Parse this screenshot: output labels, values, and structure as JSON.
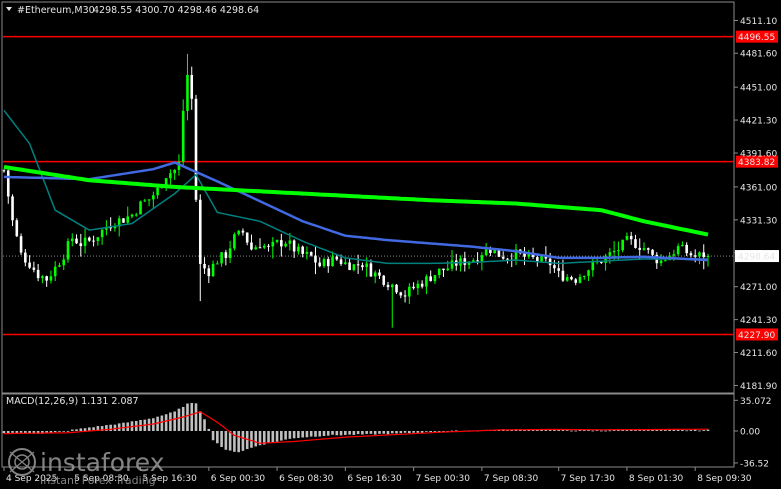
{
  "header": {
    "symbol": "#Ethereum,M30",
    "ohlc": "4298.55 4300.70 4298.46 4298.64"
  },
  "colors": {
    "background": "#000000",
    "bull_candle": "#00ff00",
    "bear_candle": "#ffffff",
    "ma_slow": "#00ff00",
    "ma_mid": "#4169e1",
    "ma_fast": "#008080",
    "level_lines": "#ff0000",
    "macd_hist": "#c0c0c0",
    "macd_signal": "#ff0000"
  },
  "watermark": {
    "brand": "instaforex",
    "tagline": "Instant Forex Trading",
    "icon": "instaforex-logo-icon"
  },
  "chart_data": {
    "type": "candlestick",
    "title": "#Ethereum,M30",
    "price_axis": {
      "ticks": [
        4511.1,
        4481.6,
        4451.0,
        4421.3,
        4391.6,
        4361.0,
        4331.3,
        4301.6,
        4271.0,
        4241.3,
        4211.6,
        4181.9
      ],
      "tick_labels": [
        "4511.10",
        "4481.60",
        "4451.00",
        "4421.30",
        "4391.60",
        "4361.00",
        "4331.30",
        "4301.60",
        "4271.00",
        "4241.30",
        "4211.60",
        "4181.90"
      ],
      "ylim": [
        4176.0,
        4526.0
      ]
    },
    "time_axis": {
      "labels": [
        "4 Sep 2025",
        "5 Sep 08:30",
        "5 Sep 16:30",
        "6 Sep 00:30",
        "6 Sep 08:30",
        "6 Sep 16:30",
        "7 Sep 00:30",
        "7 Sep 08:30",
        "7 Sep 17:30",
        "8 Sep 01:30",
        "8 Sep 09:30"
      ],
      "bar_index": [
        0,
        16,
        32,
        48,
        64,
        80,
        96,
        112,
        130,
        146,
        162
      ]
    },
    "bar_count": 166,
    "horizontal_levels": [
      {
        "price": 4496.55,
        "label": "4496.55"
      },
      {
        "price": 4383.82,
        "label": "4383.82"
      },
      {
        "price": 4227.9,
        "label": "4227.90"
      }
    ],
    "current_price": {
      "price": 4298.64,
      "label": "4298.64"
    },
    "close_anchors": [
      [
        0,
        4376
      ],
      [
        2,
        4330
      ],
      [
        4,
        4300
      ],
      [
        6,
        4292
      ],
      [
        8,
        4282
      ],
      [
        10,
        4278
      ],
      [
        12,
        4288
      ],
      [
        14,
        4300
      ],
      [
        16,
        4315
      ],
      [
        18,
        4310
      ],
      [
        20,
        4312
      ],
      [
        22,
        4318
      ],
      [
        24,
        4325
      ],
      [
        26,
        4330
      ],
      [
        28,
        4332
      ],
      [
        30,
        4336
      ],
      [
        32,
        4345
      ],
      [
        34,
        4350
      ],
      [
        36,
        4358
      ],
      [
        38,
        4372
      ],
      [
        40,
        4376
      ],
      [
        41,
        4382
      ],
      [
        42,
        4430
      ],
      [
        43,
        4462
      ],
      [
        44,
        4440
      ],
      [
        45,
        4350
      ],
      [
        46,
        4290
      ],
      [
        48,
        4285
      ],
      [
        50,
        4295
      ],
      [
        52,
        4300
      ],
      [
        54,
        4315
      ],
      [
        56,
        4320
      ],
      [
        58,
        4305
      ],
      [
        60,
        4310
      ],
      [
        62,
        4305
      ],
      [
        64,
        4310
      ],
      [
        66,
        4312
      ],
      [
        68,
        4305
      ],
      [
        70,
        4300
      ],
      [
        72,
        4298
      ],
      [
        74,
        4290
      ],
      [
        76,
        4294
      ],
      [
        78,
        4296
      ],
      [
        80,
        4292
      ],
      [
        82,
        4290
      ],
      [
        84,
        4292
      ],
      [
        86,
        4285
      ],
      [
        88,
        4280
      ],
      [
        90,
        4275
      ],
      [
        92,
        4270
      ],
      [
        94,
        4264
      ],
      [
        96,
        4270
      ],
      [
        98,
        4275
      ],
      [
        100,
        4280
      ],
      [
        102,
        4285
      ],
      [
        104,
        4288
      ],
      [
        106,
        4292
      ],
      [
        108,
        4294
      ],
      [
        110,
        4296
      ],
      [
        112,
        4302
      ],
      [
        114,
        4305
      ],
      [
        116,
        4300
      ],
      [
        118,
        4298
      ],
      [
        120,
        4300
      ],
      [
        122,
        4298
      ],
      [
        124,
        4296
      ],
      [
        126,
        4294
      ],
      [
        128,
        4292
      ],
      [
        130,
        4282
      ],
      [
        132,
        4280
      ],
      [
        134,
        4278
      ],
      [
        136,
        4285
      ],
      [
        138,
        4290
      ],
      [
        140,
        4295
      ],
      [
        142,
        4300
      ],
      [
        144,
        4305
      ],
      [
        146,
        4312
      ],
      [
        148,
        4310
      ],
      [
        150,
        4306
      ],
      [
        152,
        4298
      ],
      [
        154,
        4294
      ],
      [
        156,
        4300
      ],
      [
        158,
        4306
      ],
      [
        160,
        4302
      ],
      [
        162,
        4298
      ],
      [
        164,
        4300
      ],
      [
        165,
        4298.64
      ]
    ],
    "ma_slow_anchors": [
      [
        0,
        4379
      ],
      [
        20,
        4367
      ],
      [
        40,
        4361
      ],
      [
        60,
        4357
      ],
      [
        80,
        4353
      ],
      [
        100,
        4349
      ],
      [
        120,
        4346
      ],
      [
        140,
        4340
      ],
      [
        150,
        4330
      ],
      [
        165,
        4318
      ]
    ],
    "ma_mid_anchors": [
      [
        0,
        4370
      ],
      [
        20,
        4368
      ],
      [
        35,
        4377
      ],
      [
        40,
        4383
      ],
      [
        50,
        4366
      ],
      [
        60,
        4348
      ],
      [
        70,
        4330
      ],
      [
        80,
        4317
      ],
      [
        90,
        4313
      ],
      [
        100,
        4310
      ],
      [
        110,
        4307
      ],
      [
        120,
        4303
      ],
      [
        130,
        4297
      ],
      [
        140,
        4297
      ],
      [
        150,
        4298
      ],
      [
        165,
        4295
      ]
    ],
    "ma_fast_anchors": [
      [
        0,
        4430
      ],
      [
        6,
        4400
      ],
      [
        12,
        4340
      ],
      [
        20,
        4322
      ],
      [
        30,
        4328
      ],
      [
        40,
        4355
      ],
      [
        45,
        4372
      ],
      [
        50,
        4338
      ],
      [
        60,
        4330
      ],
      [
        70,
        4312
      ],
      [
        80,
        4297
      ],
      [
        90,
        4292
      ],
      [
        100,
        4292
      ],
      [
        110,
        4293
      ],
      [
        120,
        4295
      ],
      [
        130,
        4292
      ],
      [
        140,
        4294
      ],
      [
        150,
        4296
      ],
      [
        165,
        4296
      ]
    ],
    "macd": {
      "label": "MACD(12,26,9) 1.131 2.087",
      "ticks": [
        35.072,
        0.0,
        -36.52
      ],
      "tick_labels": [
        "35.072",
        "0.00",
        "-36.52"
      ],
      "ylim": [
        -40.0,
        40.0
      ],
      "hist_anchors": [
        [
          0,
          -2
        ],
        [
          10,
          -3
        ],
        [
          20,
          4
        ],
        [
          28,
          9
        ],
        [
          35,
          15
        ],
        [
          40,
          22
        ],
        [
          43,
          31
        ],
        [
          45,
          32
        ],
        [
          47,
          14
        ],
        [
          49,
          -10
        ],
        [
          52,
          -22
        ],
        [
          55,
          -24
        ],
        [
          60,
          -16
        ],
        [
          68,
          -8
        ],
        [
          76,
          -5
        ],
        [
          84,
          -4
        ],
        [
          92,
          -3
        ],
        [
          100,
          -1
        ],
        [
          108,
          0.5
        ],
        [
          116,
          1.5
        ],
        [
          124,
          2
        ],
        [
          132,
          1
        ],
        [
          140,
          0.5
        ],
        [
          146,
          2
        ],
        [
          150,
          1.5
        ],
        [
          158,
          1
        ],
        [
          165,
          1.131
        ]
      ],
      "signal_anchors": [
        [
          0,
          -3
        ],
        [
          15,
          -2
        ],
        [
          25,
          2
        ],
        [
          35,
          8
        ],
        [
          42,
          16
        ],
        [
          46,
          22
        ],
        [
          50,
          10
        ],
        [
          54,
          -5
        ],
        [
          60,
          -14
        ],
        [
          68,
          -12
        ],
        [
          80,
          -7
        ],
        [
          92,
          -4
        ],
        [
          104,
          -1
        ],
        [
          116,
          1.2
        ],
        [
          128,
          1.8
        ],
        [
          140,
          1.4
        ],
        [
          150,
          1.6
        ],
        [
          165,
          2.087
        ]
      ]
    }
  }
}
